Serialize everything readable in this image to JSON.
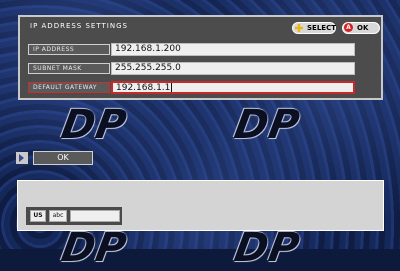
{
  "panel": {
    "title": "IP ADDRESS SETTINGS",
    "select_label": "SELECT",
    "ok_label": "OK",
    "a_glyph": "A",
    "rows": [
      {
        "label": "IP ADDRESS",
        "value": "192.168.1.200"
      },
      {
        "label": "SUBNET MASK",
        "value": "255.255.255.0"
      },
      {
        "label": "DEFAULT GATEWAY",
        "value": "192.168.1.1"
      }
    ]
  },
  "ok_button": {
    "label": "OK"
  },
  "keyboard": {
    "lang": "US",
    "mode": "abc"
  },
  "background": {
    "logo_text": "DP"
  },
  "colors": {
    "accent_red": "#c82828",
    "panel_gray": "#4c4c4c"
  }
}
